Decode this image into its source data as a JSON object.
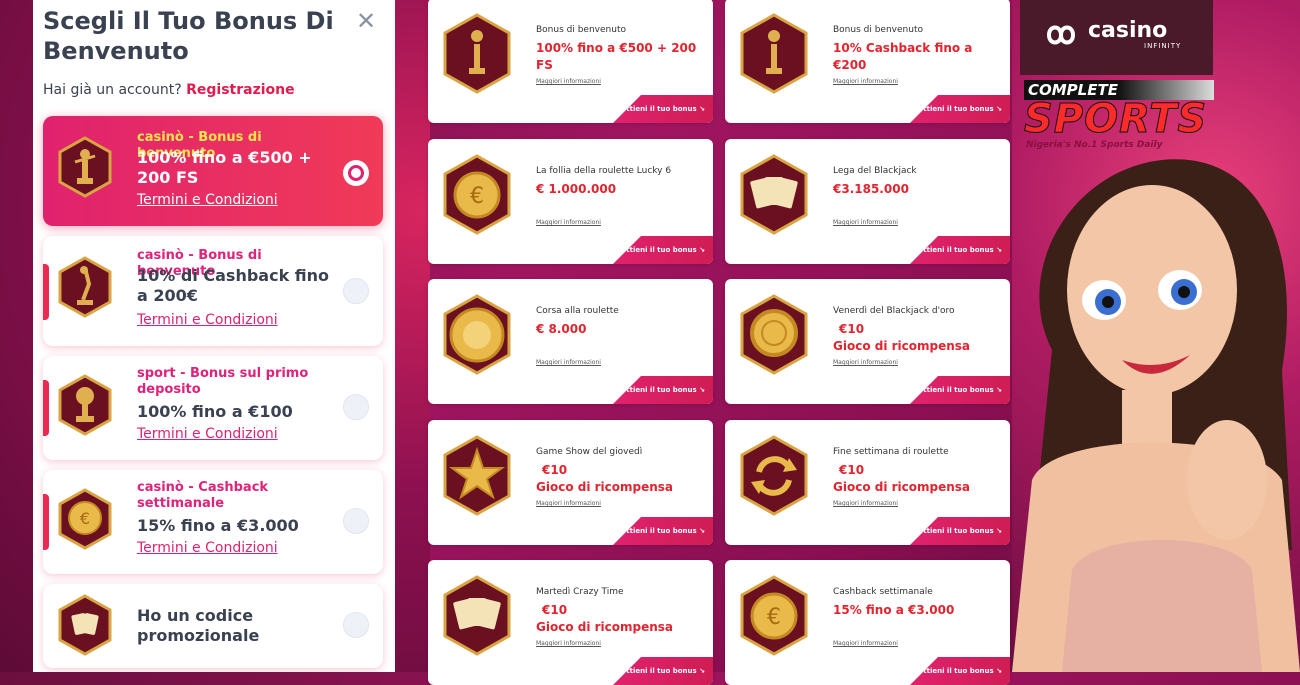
{
  "modal": {
    "title": "Scegli Il Tuo Bonus Di Benvenuto",
    "account_prompt": "Hai già un account?",
    "register_link": "Registrazione",
    "options": [
      {
        "category": "casinò - Bonus di benvenuto",
        "offer": "100% fino a €500 + 200 FS",
        "terms": "Termini e Condizioni",
        "selected": true,
        "icon": "trophy-athlete-icon"
      },
      {
        "category": "casinò - Bonus di benvenuto",
        "offer": "10% di Cashback fino a 200€",
        "terms": "Termini e Condizioni",
        "selected": false,
        "icon": "trophy-dancer-icon"
      },
      {
        "category": "sport - Bonus sul primo deposito",
        "offer": "100% fino a €100",
        "terms": "Termini e Condizioni",
        "selected": false,
        "icon": "football-trophy-icon"
      },
      {
        "category": "casinò - Cashback settimanale",
        "offer": "15% fino a €3.000",
        "terms": "Termini e Condizioni",
        "selected": false,
        "icon": "euro-coin-icon"
      },
      {
        "category": "",
        "offer": "Ho un codice promozionale",
        "terms": "",
        "selected": false,
        "icon": "promo-cards-icon"
      }
    ]
  },
  "cards": [
    {
      "title": "Bonus di benvenuto",
      "amount": "100% fino a €500 + 200 FS",
      "more": "Maggiori informazioni",
      "cta": "Ottieni il tuo bonus",
      "icon": "trophy-athlete-icon"
    },
    {
      "title": "Bonus di benvenuto",
      "amount": "10% Cashback fino a €200",
      "more": "Maggiori informazioni",
      "cta": "Ottieni il tuo bonus",
      "icon": "trophy-dancer-icon"
    },
    {
      "title": "La follia della roulette Lucky 6",
      "amount": "€ 1.000.000",
      "more": "Maggiori informazioni",
      "cta": "Ottieni il tuo bonus",
      "icon": "euro-coin-icon"
    },
    {
      "title": "Lega del Blackjack",
      "amount": "€3.185.000",
      "more": "Maggiori informazioni",
      "cta": "Ottieni il tuo bonus",
      "icon": "playing-cards-icon"
    },
    {
      "title": "Corsa alla roulette",
      "amount": "€ 8.000",
      "more": "Maggiori informazioni",
      "cta": "Ottieni il tuo bonus",
      "icon": "roulette-wheel-icon"
    },
    {
      "title": "Venerdì del Blackjack d'oro",
      "amount": "€10\nGioco di ricompensa",
      "more": "Maggiori informazioni",
      "cta": "Ottieni il tuo bonus",
      "icon": "gold-chip-icon"
    },
    {
      "title": "Game Show del giovedì",
      "amount": "€10\nGioco di ricompensa",
      "more": "Maggiori informazioni",
      "cta": "Ottieni il tuo bonus",
      "icon": "star-icon"
    },
    {
      "title": "Fine settimana di roulette",
      "amount": "€10\nGioco di ricompensa",
      "more": "Maggiori informazioni",
      "cta": "Ottieni il tuo bonus",
      "icon": "refresh-arrows-icon"
    },
    {
      "title": "Martedì Crazy Time",
      "amount": "€10\nGioco di ricompensa",
      "more": "Maggiori informazioni",
      "cta": "Ottieni il tuo bonus",
      "icon": "playing-cards-icon"
    },
    {
      "title": "Cashback settimanale",
      "amount": "15% fino a €3.000",
      "more": "Maggiori informazioni",
      "cta": "Ottieni il tuo bonus",
      "icon": "euro-coin-icon"
    }
  ],
  "promo": {
    "brand": "casino",
    "brand_sub": "INFINITY",
    "partner_top": "COMPLETE",
    "partner_main": "SPORTS",
    "partner_tag": "Nigeria's No.1 Sports Daily"
  },
  "colors": {
    "accent": "#e0226e",
    "amount_red": "#e2242f",
    "text_dark": "#3a4150"
  }
}
